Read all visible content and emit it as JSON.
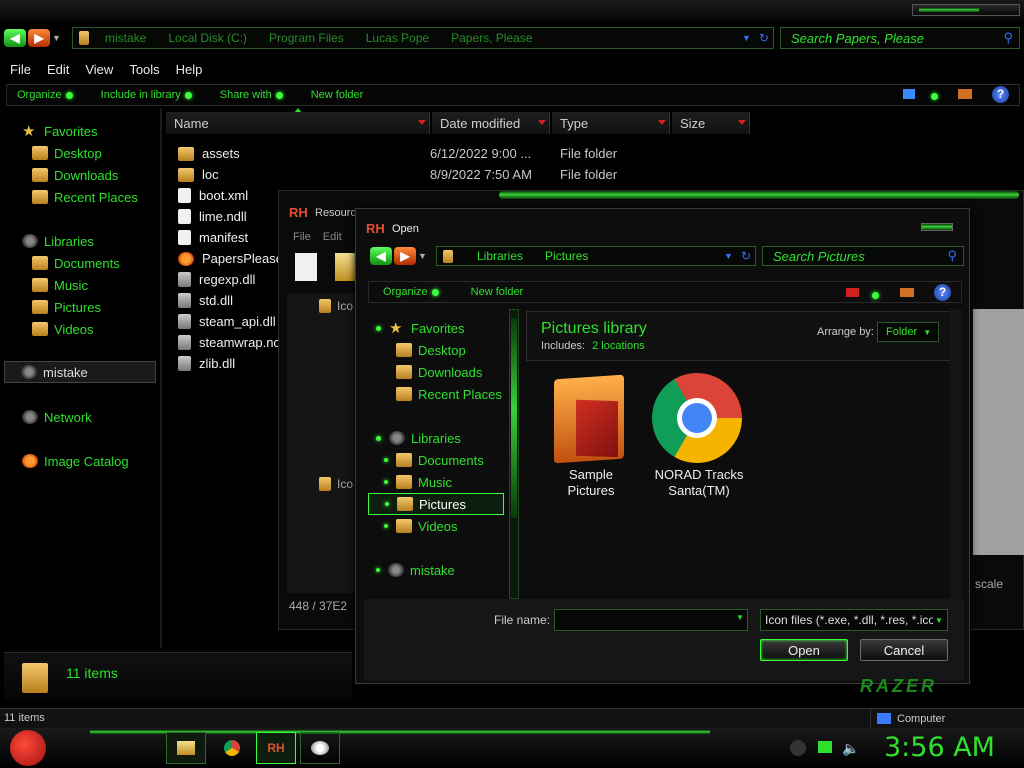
{
  "explorer": {
    "nav": {
      "back_icon": "back-arrow-icon",
      "forward_icon": "forward-arrow-icon"
    },
    "breadcrumb": [
      "mistake",
      "Local Disk (C:)",
      "Program Files",
      "Lucas Pope",
      "Papers, Please"
    ],
    "search_placeholder": "Search Papers, Please",
    "menu": [
      "File",
      "Edit",
      "View",
      "Tools",
      "Help"
    ],
    "toolbar": {
      "organize": "Organize",
      "include": "Include in library",
      "share": "Share with",
      "new_folder": "New folder"
    },
    "sidebar": {
      "favorites": "Favorites",
      "fav_items": [
        "Desktop",
        "Downloads",
        "Recent Places"
      ],
      "libraries": "Libraries",
      "lib_items": [
        "Documents",
        "Music",
        "Pictures",
        "Videos"
      ],
      "computer": "mistake",
      "network": "Network",
      "image_catalog": "Image Catalog"
    },
    "columns": {
      "name": "Name",
      "date": "Date modified",
      "type": "Type",
      "size": "Size"
    },
    "files": [
      {
        "name": "assets",
        "date": "6/12/2022 9:00 ...",
        "type": "File folder",
        "icon": "folder"
      },
      {
        "name": "loc",
        "date": "8/9/2022 7:50 AM",
        "type": "File folder",
        "icon": "folder"
      },
      {
        "name": "boot.xml",
        "date": "",
        "type": "",
        "icon": "xml"
      },
      {
        "name": "lime.ndll",
        "date": "",
        "type": "",
        "icon": "file"
      },
      {
        "name": "manifest",
        "date": "",
        "type": "",
        "icon": "file"
      },
      {
        "name": "PapersPlease",
        "date": "",
        "type": "",
        "icon": "exe"
      },
      {
        "name": "regexp.dll",
        "date": "",
        "type": "",
        "icon": "dll"
      },
      {
        "name": "std.dll",
        "date": "",
        "type": "",
        "icon": "dll"
      },
      {
        "name": "steam_api.dll",
        "date": "",
        "type": "",
        "icon": "dll"
      },
      {
        "name": "steamwrap.nc",
        "date": "",
        "type": "",
        "icon": "dll"
      },
      {
        "name": "zlib.dll",
        "date": "",
        "type": "",
        "icon": "dll"
      }
    ],
    "details_count": "11 items",
    "status_count": "11 items",
    "status_computer": "Computer"
  },
  "resource_hacker": {
    "title": "Resource",
    "menu": [
      "File",
      "Edit"
    ],
    "tree_items": [
      "Ico",
      "Ico"
    ],
    "status": "448 / 37E2",
    "scale_label": "scale"
  },
  "open_dialog": {
    "title": "Open",
    "breadcrumb": [
      "Libraries",
      "Pictures"
    ],
    "search_placeholder": "Search Pictures",
    "toolbar": {
      "organize": "Organize",
      "new_folder": "New folder"
    },
    "tree": {
      "favorites": "Favorites",
      "fav_items": [
        "Desktop",
        "Downloads",
        "Recent Places"
      ],
      "libraries": "Libraries",
      "lib_items": [
        "Documents",
        "Music",
        "Pictures",
        "Videos"
      ],
      "computer": "mistake"
    },
    "library": {
      "title": "Pictures library",
      "includes_label": "Includes:",
      "includes_link": "2 locations",
      "arrange_label": "Arrange by:",
      "arrange_value": "Folder"
    },
    "items": [
      {
        "label_line1": "Sample",
        "label_line2": "Pictures",
        "icon": "sample-pictures-folder-icon"
      },
      {
        "label_line1": "NORAD Tracks",
        "label_line2": "Santa(TM)",
        "icon": "chrome-icon"
      }
    ],
    "file_name_label": "File name:",
    "file_name_value": "",
    "filter_value": "Icon files (*.exe, *.dll, *.res, *.ico)",
    "open_button": "Open",
    "cancel_button": "Cancel"
  },
  "taskbar": {
    "clock": "3:56 AM",
    "brand": "RAZER",
    "rh_label": "RH"
  },
  "colors": {
    "accent": "#2fe02f",
    "glow": "#3cff3c",
    "background": "#000000"
  }
}
